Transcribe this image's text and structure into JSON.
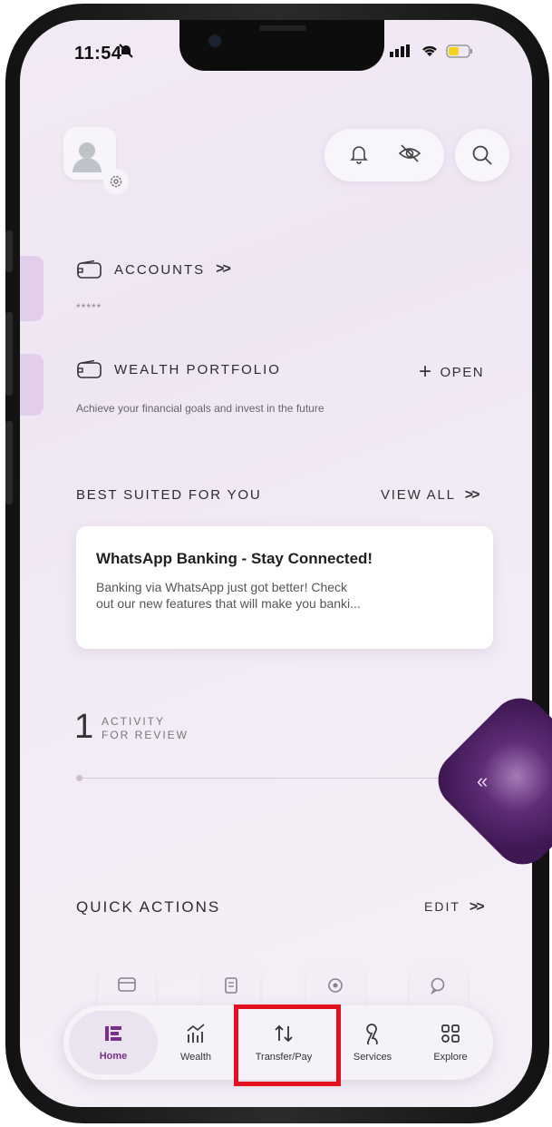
{
  "status_bar": {
    "time": "11:54"
  },
  "accounts": {
    "label": "ACCOUNTS",
    "masked_value": "*****"
  },
  "wealth": {
    "label": "WEALTH PORTFOLIO",
    "open_label": "OPEN",
    "description": "Achieve your financial goals and invest in the future"
  },
  "best_suited": {
    "title": "BEST SUITED FOR YOU",
    "view_all": "VIEW ALL",
    "card": {
      "title": "WhatsApp Banking - Stay Connected!",
      "body_line1": "Banking via WhatsApp just got better! Check",
      "body_line2": "out our new features that will make you banki..."
    }
  },
  "activity": {
    "count": "1",
    "line1": "ACTIVITY",
    "line2": "FOR REVIEW"
  },
  "quick_actions": {
    "title": "QUICK ACTIONS",
    "edit": "EDIT"
  },
  "tabs": [
    {
      "label": "Home",
      "icon": "home-icon",
      "active": true
    },
    {
      "label": "Wealth",
      "icon": "wealth-chart-icon"
    },
    {
      "label": "Transfer/Pay",
      "icon": "transfer-arrows-icon",
      "highlighted": true
    },
    {
      "label": "Services",
      "icon": "services-icon"
    },
    {
      "label": "Explore",
      "icon": "explore-grid-icon"
    }
  ],
  "colors": {
    "accent": "#7a2f8c",
    "highlight": "#e3101f",
    "background": "#f2eaf5"
  }
}
